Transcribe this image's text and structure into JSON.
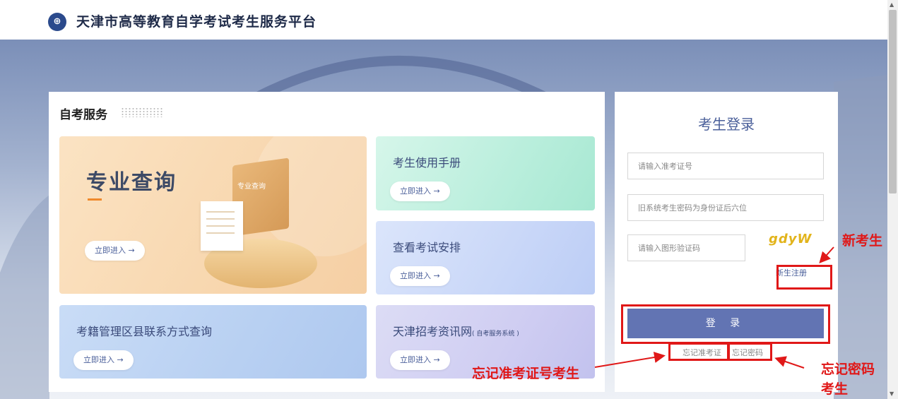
{
  "header": {
    "title": "天津市高等教育自学考试考生服务平台",
    "logo_text": "⊕"
  },
  "services": {
    "title": "自考服务",
    "enter_label": "立即进入 →",
    "cards": {
      "major": {
        "title": "专业查询",
        "book_label": "专业查询"
      },
      "manual": {
        "title": "考生使用手册"
      },
      "exam": {
        "title": "查看考试安排"
      },
      "district": {
        "title": "考籍管理区县联系方式查询"
      },
      "zhaokao": {
        "title": "天津招考资讯网",
        "subtitle": "( 自考服务系统 )"
      }
    }
  },
  "login": {
    "title": "考生登录",
    "id_placeholder": "请输入准考证号",
    "password_placeholder": "旧系统考生密码为身份证后六位",
    "captcha_placeholder": "请输入图形验证码",
    "captcha_text": "gdyW",
    "register_label": "新生注册",
    "login_button": "登 录",
    "forget_id": "忘记准考证",
    "forget_password": "忘记密码"
  },
  "annotations": {
    "new_student": "新考生",
    "forget_id_student": "忘记准考证号考生",
    "forget_password_student_line1": "忘记密码",
    "forget_password_student_line2": "考生"
  },
  "colors": {
    "accent": "#6274b3",
    "annotation": "#e01818"
  }
}
